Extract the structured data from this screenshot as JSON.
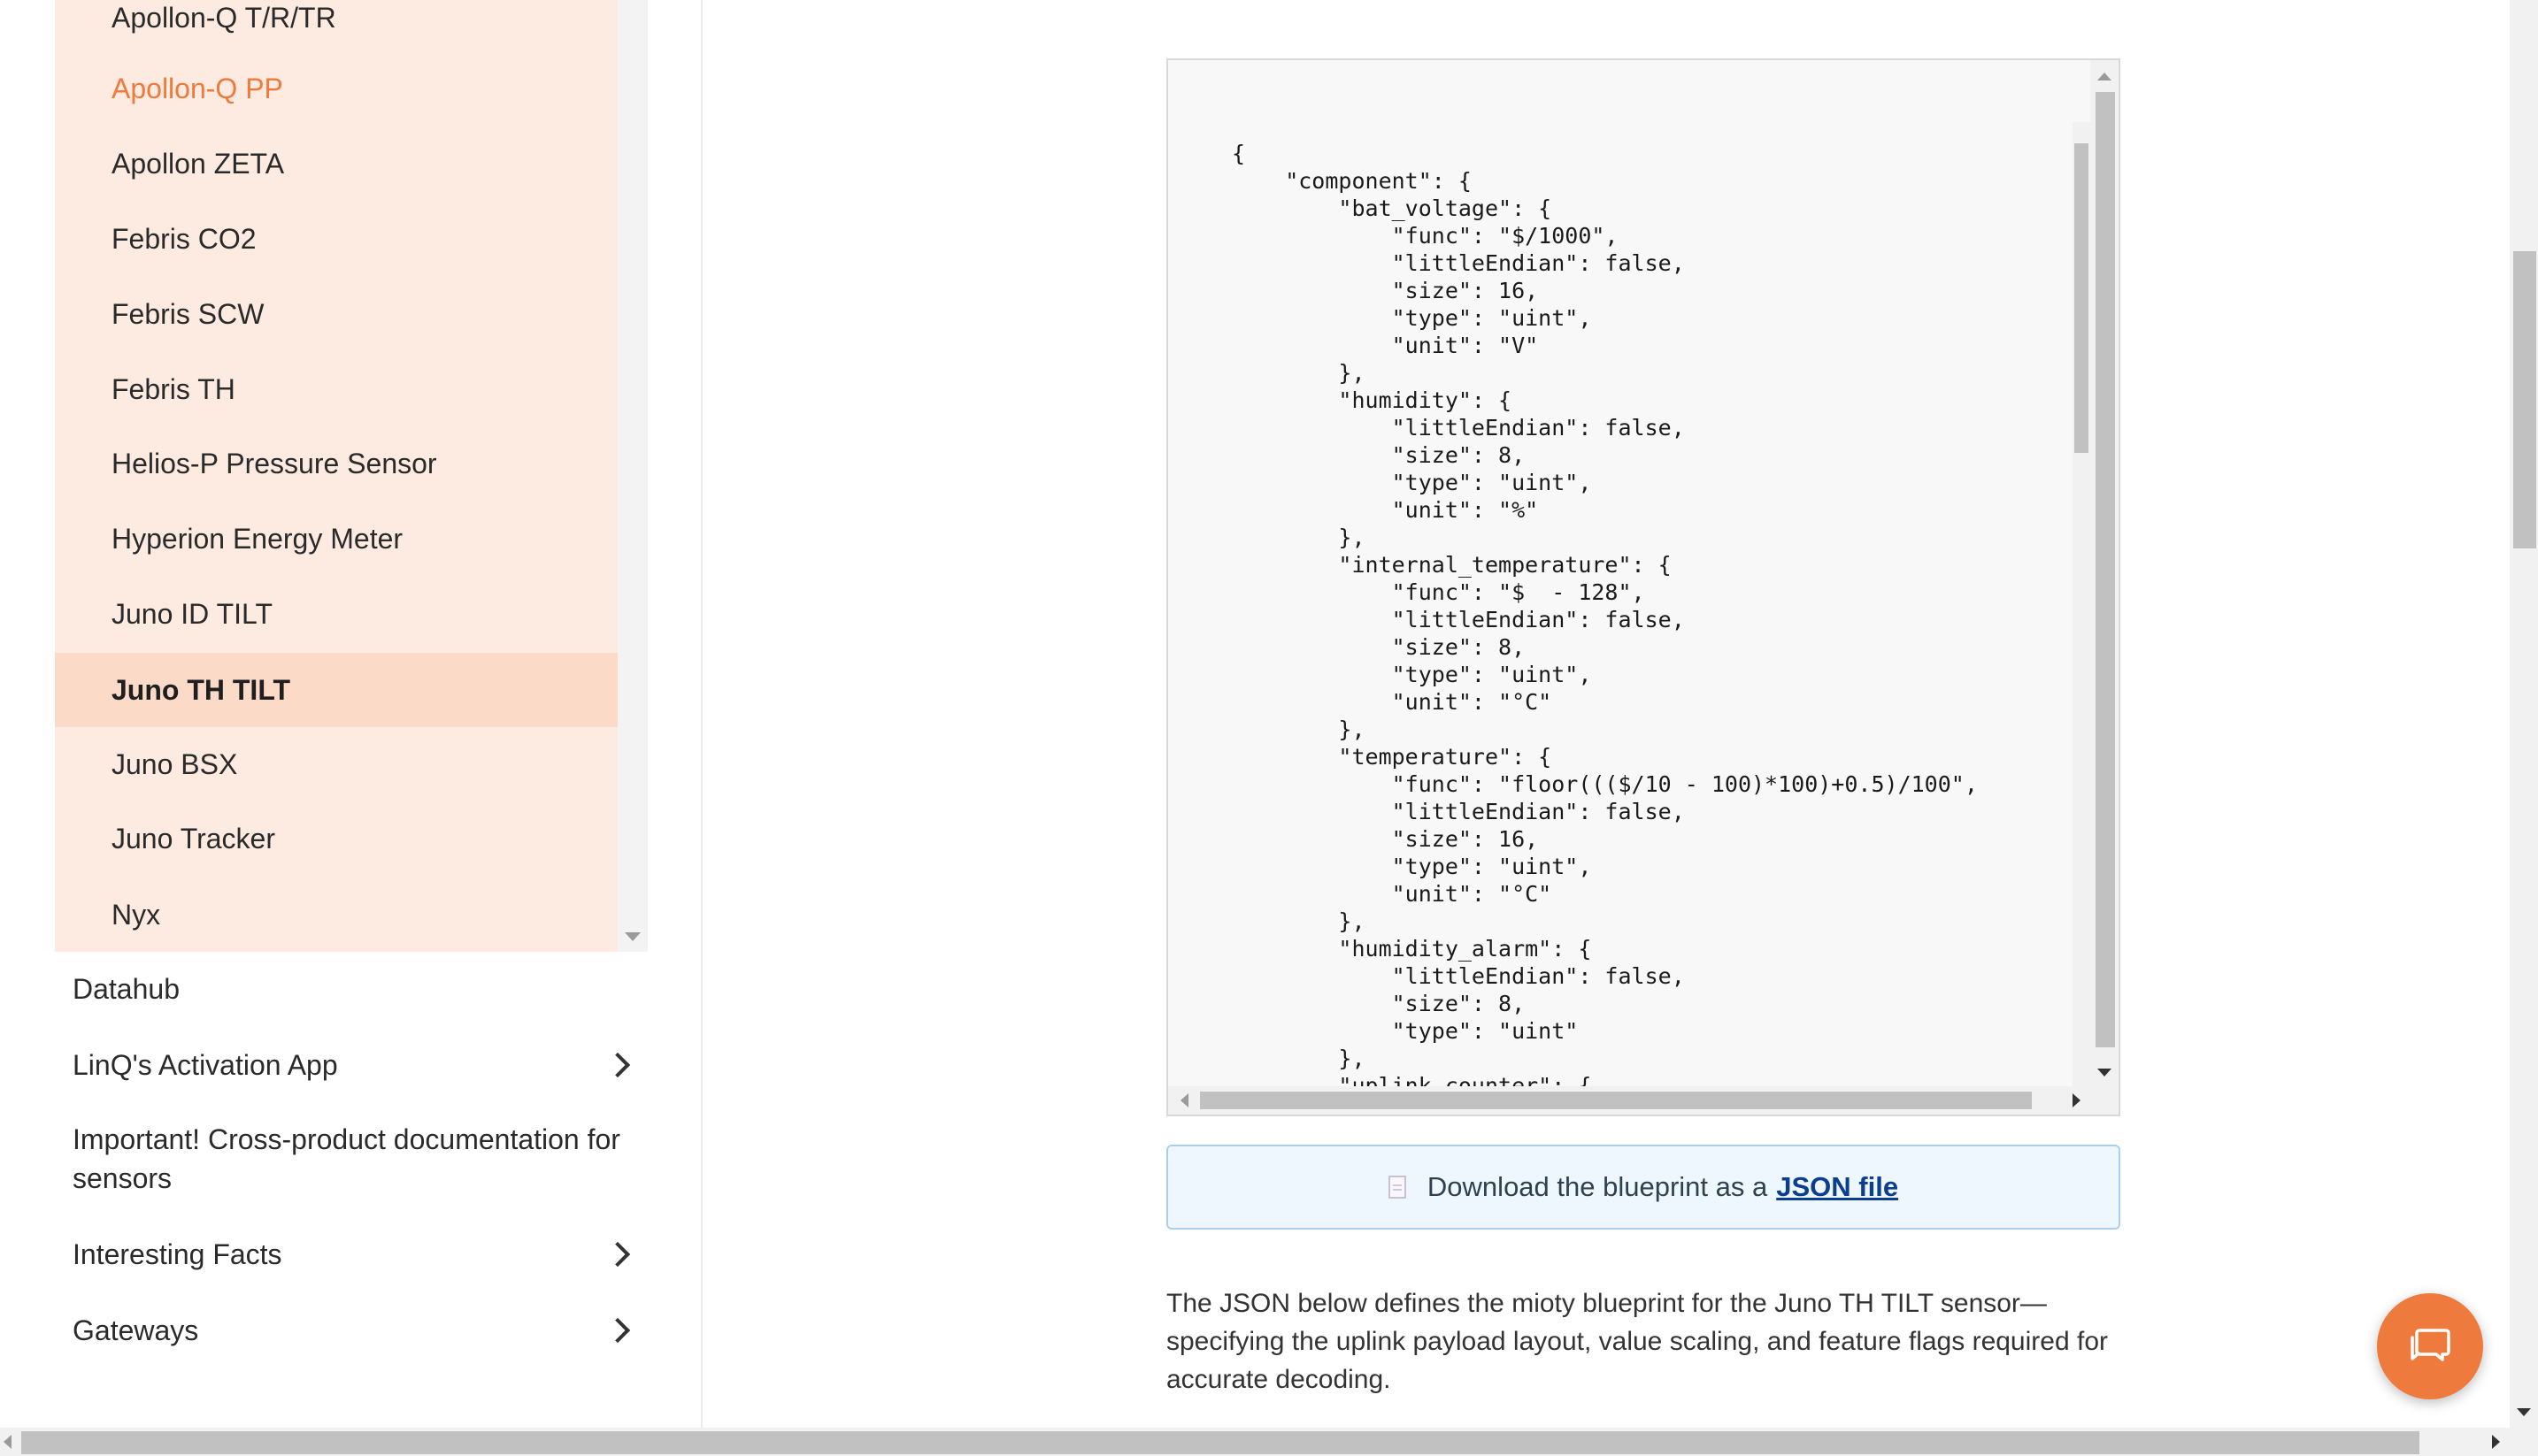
{
  "sidebar": {
    "sub_items": [
      {
        "label": "Apollon-Q T/R/TR"
      },
      {
        "label": "Apollon-Q PP"
      },
      {
        "label": "Apollon ZETA"
      },
      {
        "label": "Febris CO2"
      },
      {
        "label": "Febris SCW"
      },
      {
        "label": "Febris TH"
      },
      {
        "label": "Helios-P Pressure Sensor"
      },
      {
        "label": "Hyperion Energy Meter"
      },
      {
        "label": "Juno ID TILT"
      },
      {
        "label": "Juno TH TILT"
      },
      {
        "label": "Juno BSX"
      },
      {
        "label": "Juno Tracker"
      },
      {
        "label": "Nyx"
      }
    ],
    "highlighted_item": "Apollon-Q PP",
    "selected_item": "Juno TH TILT",
    "nav_items": [
      {
        "label": "Datahub"
      },
      {
        "label": "LinQ's Activation App"
      },
      {
        "label": "Important! Cross-product documentation for sensors"
      },
      {
        "label": "Interesting Facts"
      },
      {
        "label": "Gateways"
      }
    ]
  },
  "code_block": {
    "content": "{\n    \"component\": {\n        \"bat_voltage\": {\n            \"func\": \"$/1000\",\n            \"littleEndian\": false,\n            \"size\": 16,\n            \"type\": \"uint\",\n            \"unit\": \"V\"\n        },\n        \"humidity\": {\n            \"littleEndian\": false,\n            \"size\": 8,\n            \"type\": \"uint\",\n            \"unit\": \"%\"\n        },\n        \"internal_temperature\": {\n            \"func\": \"$  - 128\",\n            \"littleEndian\": false,\n            \"size\": 8,\n            \"type\": \"uint\",\n            \"unit\": \"°C\"\n        },\n        \"temperature\": {\n            \"func\": \"floor((($/10 - 100)*100)+0.5)/100\",\n            \"littleEndian\": false,\n            \"size\": 16,\n            \"type\": \"uint\",\n            \"unit\": \"°C\"\n        },\n        \"humidity_alarm\": {\n            \"littleEndian\": false,\n            \"size\": 8,\n            \"type\": \"uint\"\n        },\n        \"uplink_counter\": {"
  },
  "download": {
    "prefix": "Download the blueprint as a",
    "link_label": "JSON file"
  },
  "description": "The JSON below defines the mioty blueprint for the Juno TH TILT sensor—specifying the uplink payload layout, value scaling, and feature flags required for accurate decoding.",
  "icons": {
    "file": "file-icon",
    "chevron": "chevron-right-icon",
    "chat": "chat-icon"
  },
  "colors": {
    "accent": "#ef7a3d",
    "sidebar_bg": "#fdebe1",
    "selected_bg": "#fbdac8",
    "link": "#0b3d91",
    "download_bg": "#eef7fd"
  }
}
